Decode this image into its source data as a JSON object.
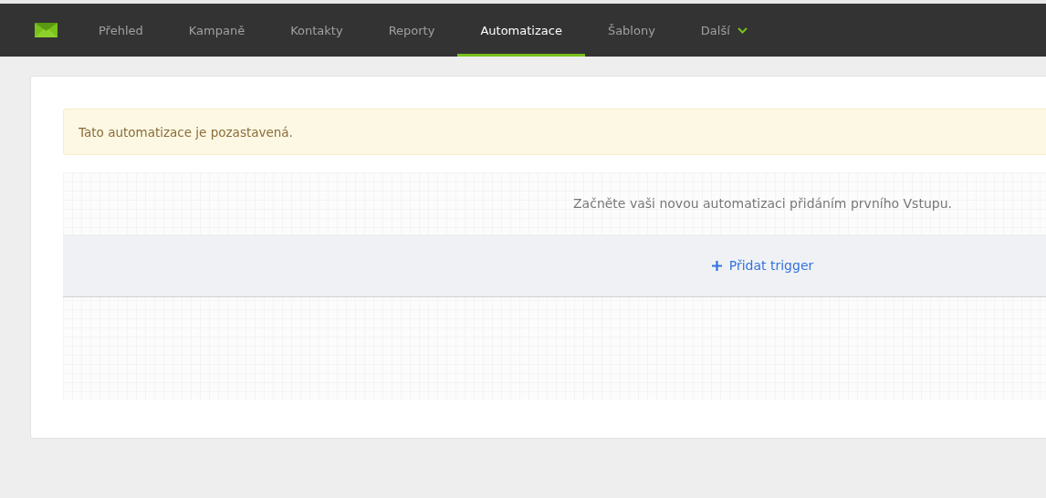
{
  "nav": {
    "items": [
      {
        "label": "Přehled",
        "selected": false
      },
      {
        "label": "Kampaně",
        "selected": false
      },
      {
        "label": "Kontakty",
        "selected": false
      },
      {
        "label": "Reporty",
        "selected": false
      },
      {
        "label": "Automatizace",
        "selected": true
      },
      {
        "label": "Šablony",
        "selected": false
      },
      {
        "label": "Další",
        "selected": false,
        "kind": "dropdown"
      }
    ]
  },
  "alert": {
    "text": "Tato automatizace je pozastavená."
  },
  "canvas": {
    "message": "Začněte vaši novou automatizaci přidáním prvního Vstupu.",
    "add_button": "Přidat trigger"
  }
}
